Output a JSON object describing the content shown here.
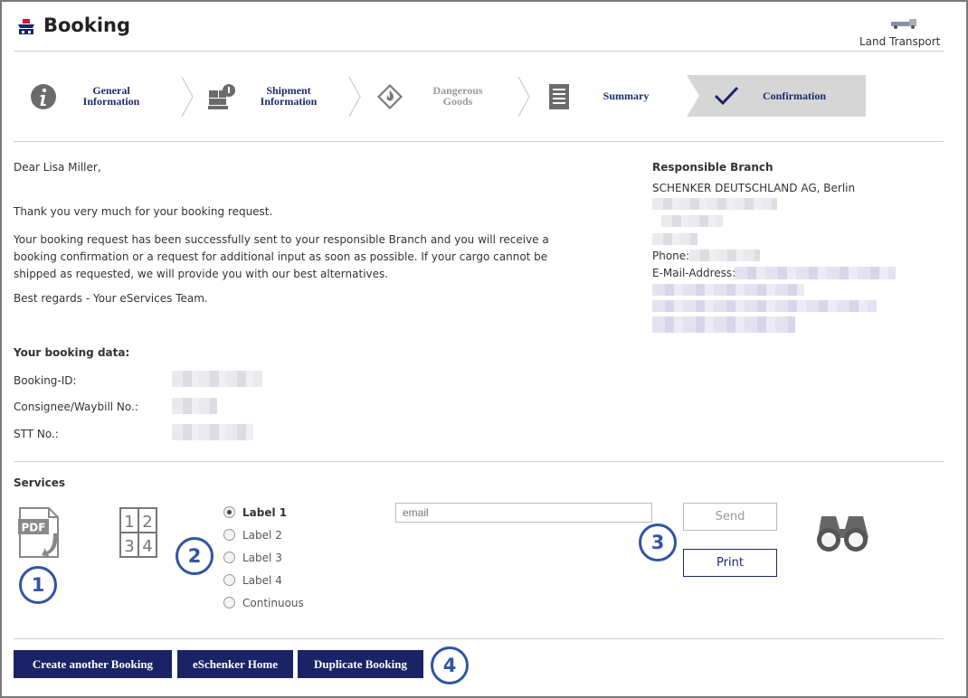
{
  "header": {
    "title": "Booking",
    "mode_label": "Land Transport"
  },
  "steps": [
    {
      "line1": "General",
      "line2": "Information",
      "icon": "info-icon",
      "state": "done"
    },
    {
      "line1": "Shipment",
      "line2": "Information",
      "icon": "pallet-icon",
      "state": "done"
    },
    {
      "line1": "Dangerous",
      "line2": "Goods",
      "icon": "flame-diamond-icon",
      "state": "disabled"
    },
    {
      "line1": "Summary",
      "line2": "",
      "icon": "document-icon",
      "state": "done"
    },
    {
      "line1": "Confirmation",
      "line2": "",
      "icon": "checkmark-icon",
      "state": "active"
    }
  ],
  "message": {
    "greeting": "Dear Lisa Miller,",
    "thanks": "Thank you very much for your booking request.",
    "body_line1": "Your booking request has been successfully sent to your responsible Branch and you will receive a",
    "body_line2": "booking confirmation or a request for additional input as soon as possible. If your cargo cannot be",
    "body_line3": "shipped as requested, we will provide you with our best alternatives.",
    "regards": "Best regards - Your eServices Team."
  },
  "branch": {
    "heading": "Responsible Branch",
    "name": "SCHENKER DEUTSCHLAND AG, Berlin",
    "phone_label": "Phone:",
    "email_label": "E-Mail-Address:"
  },
  "booking_data": {
    "heading": "Your booking data:",
    "rows": [
      {
        "label": "Booking-ID:"
      },
      {
        "label": "Consignee/Waybill No.:"
      },
      {
        "label": "STT No.:"
      }
    ]
  },
  "services": {
    "heading": "Services",
    "labels": [
      "Label 1",
      "Label 2",
      "Label 3",
      "Label 4",
      "Continuous"
    ],
    "selected": "Label 1",
    "email_placeholder": "email",
    "send_label": "Send",
    "print_label": "Print"
  },
  "callouts": [
    "1",
    "2",
    "3",
    "4"
  ],
  "footer_buttons": {
    "create": "Create another Booking",
    "home": "eSchenker Home",
    "duplicate": "Duplicate Booking"
  },
  "colors": {
    "navy": "#1a2366",
    "callout": "#2f55a4",
    "logo_red": "#d8172c"
  }
}
